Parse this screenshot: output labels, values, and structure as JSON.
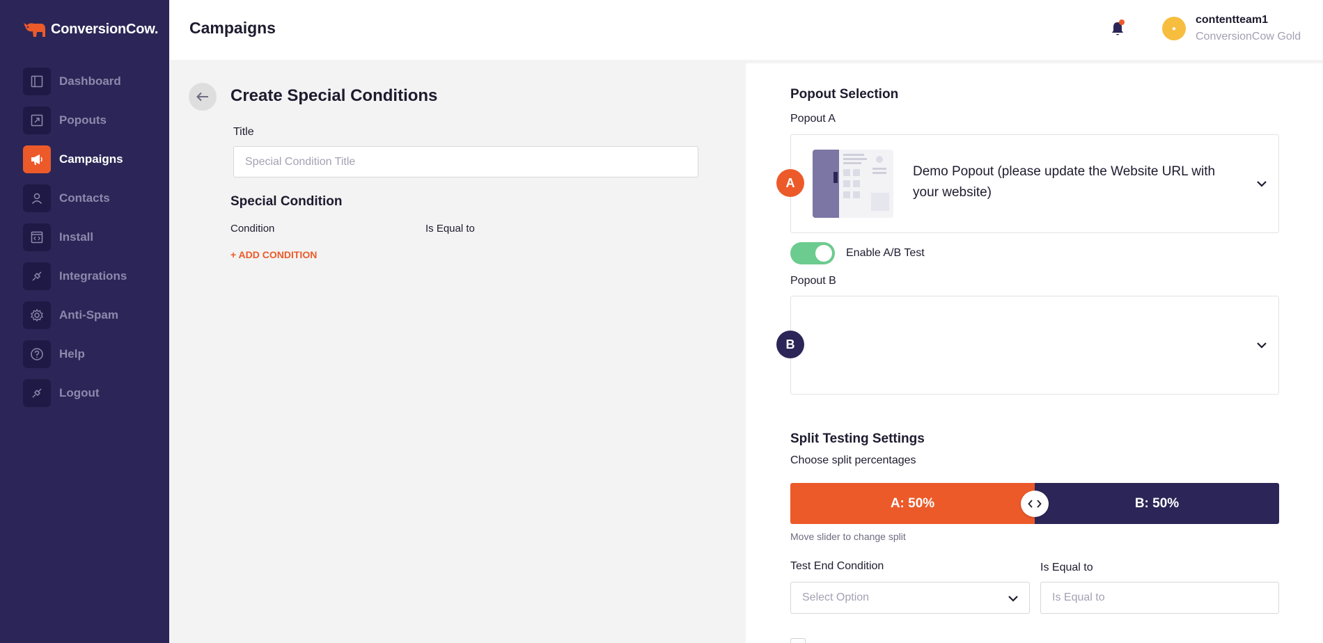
{
  "brand": {
    "name": "ConversionCow."
  },
  "sidebar": {
    "items": [
      {
        "label": "Dashboard",
        "icon": "dashboard-icon",
        "active": false
      },
      {
        "label": "Popouts",
        "icon": "popouts-icon",
        "active": false
      },
      {
        "label": "Campaigns",
        "icon": "megaphone-icon",
        "active": true
      },
      {
        "label": "Contacts",
        "icon": "user-icon",
        "active": false
      },
      {
        "label": "Install",
        "icon": "code-icon",
        "active": false
      },
      {
        "label": "Integrations",
        "icon": "plug-icon",
        "active": false
      },
      {
        "label": "Anti-Spam",
        "icon": "gear-icon",
        "active": false
      },
      {
        "label": "Help",
        "icon": "help-icon",
        "active": false
      },
      {
        "label": "Logout",
        "icon": "logout-icon",
        "active": false
      }
    ]
  },
  "header": {
    "title": "Campaigns",
    "user": {
      "name": "contentteam1",
      "plan": "ConversionCow Gold"
    }
  },
  "form": {
    "title": "Create Special Conditions",
    "title_label": "Title",
    "title_placeholder": "Special Condition Title",
    "special_condition_heading": "Special Condition",
    "condition_label": "Condition",
    "is_equal_label": "Is Equal to",
    "add_condition": "+ ADD CONDITION"
  },
  "popout_selection": {
    "heading": "Popout Selection",
    "popout_a_label": "Popout A",
    "popout_a_badge": "A",
    "popout_a_value": "Demo Popout (please update the Website URL with your website)",
    "ab_toggle_label": "Enable A/B Test",
    "ab_enabled": true,
    "popout_b_label": "Popout B",
    "popout_b_badge": "B",
    "popout_b_value": ""
  },
  "split_testing": {
    "heading": "Split Testing Settings",
    "subheading": "Choose split percentages",
    "a_label": "A: 50%",
    "b_label": "B: 50%",
    "a_fraction": 0.5,
    "hint": "Move slider to change split",
    "end_condition_label": "Test End Condition",
    "end_condition_placeholder": "Select Option",
    "is_equal_label": "Is Equal to",
    "is_equal_placeholder": "Is Equal to"
  },
  "colors": {
    "sidebar": "#2b2657",
    "accent": "#ec5a2a",
    "toggle_on": "#6ccb8e",
    "badge_b": "#2b2657"
  }
}
